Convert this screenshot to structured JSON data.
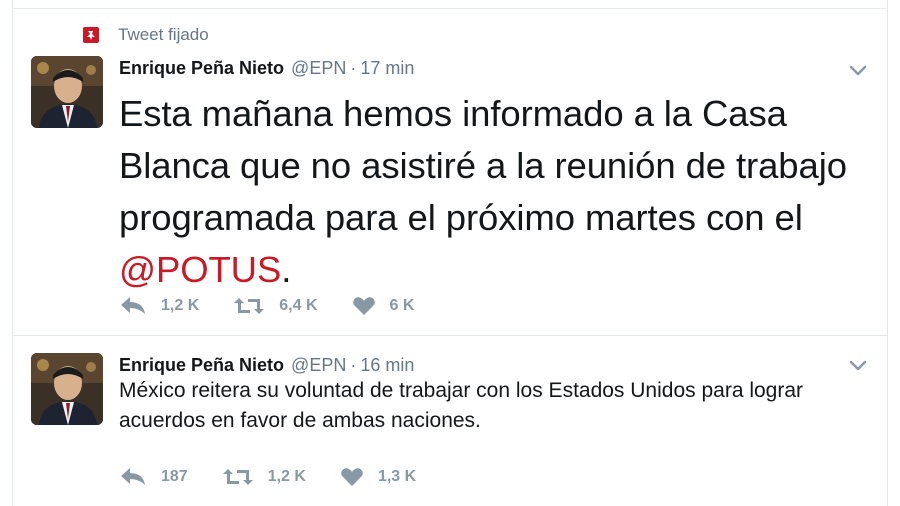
{
  "pinned_label": "Tweet fijado",
  "colors": {
    "accent": "#c81b27",
    "muted": "#657786",
    "action": "#8899a6",
    "border": "#e1e8ed"
  },
  "tweets": [
    {
      "name": "Enrique Peña Nieto",
      "handle": "@EPN",
      "separator": "·",
      "time": "17 min",
      "text_before": "Esta mañana hemos informado a la Casa Blanca que no asistiré a la reunión de trabajo programada para el próximo martes con el ",
      "mention": "@POTUS",
      "text_after": ".",
      "reply_count": "1,2 K",
      "retweet_count": "6,4 K",
      "like_count": "6 K"
    },
    {
      "name": "Enrique Peña Nieto",
      "handle": "@EPN",
      "separator": "·",
      "time": "16 min",
      "text": "México reitera su voluntad de trabajar con los Estados Unidos para lograr acuerdos en favor de ambas naciones.",
      "reply_count": "187",
      "retweet_count": "1,2 K",
      "like_count": "1,3 K"
    }
  ]
}
